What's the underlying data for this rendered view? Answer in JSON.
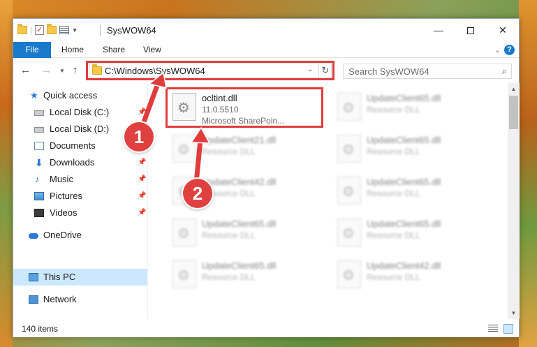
{
  "window": {
    "title": "SysWOW64",
    "controls": {
      "minimize": "—",
      "close": "✕"
    }
  },
  "ribbon": {
    "tabs": [
      "File",
      "Home",
      "Share",
      "View"
    ],
    "help": "?"
  },
  "nav": {
    "address": "C:\\Windows\\SysWOW64",
    "search_placeholder": "Search SysWOW64"
  },
  "sidebar": {
    "items": [
      {
        "label": "Quick access"
      },
      {
        "label": "Local Disk (C:)",
        "pinned": true
      },
      {
        "label": "Local Disk (D:)"
      },
      {
        "label": "Documents",
        "pinned": true
      },
      {
        "label": "Downloads",
        "pinned": true
      },
      {
        "label": "Music",
        "pinned": true
      },
      {
        "label": "Pictures",
        "pinned": true
      },
      {
        "label": "Videos",
        "pinned": true
      },
      {
        "label": "OneDrive"
      },
      {
        "label": "This PC",
        "selected": true
      },
      {
        "label": "Network"
      }
    ]
  },
  "files": [
    {
      "name": "ocltint.dll",
      "line1": "11.0.5510",
      "line2": "Microsoft SharePoin...",
      "highlighted": true
    },
    {
      "name": "UpdateClient65.dll",
      "line1": "Resource DLL"
    },
    {
      "name": "UpdateClient21.dll",
      "line1": "Resource DLL"
    },
    {
      "name": "UpdateClient65.dll",
      "line1": "Resource DLL"
    },
    {
      "name": "UpdateClient42.dll",
      "line1": "Resource DLL"
    },
    {
      "name": "UpdateClient65.dll",
      "line1": "Resource DLL"
    },
    {
      "name": "UpdateClient65.dll",
      "line1": "Resource DLL"
    },
    {
      "name": "UpdateClient65.dll",
      "line1": "Resource DLL"
    },
    {
      "name": "UpdateClient65.dll",
      "line1": "Resource DLL"
    },
    {
      "name": "UpdateClient42.dll",
      "line1": "Resource DLL"
    }
  ],
  "status": {
    "count": "140 items"
  },
  "annotations": {
    "badge1": "1",
    "badge2": "2",
    "accent_color": "#e03c3c"
  },
  "icons": {
    "pin": "📌",
    "refresh": "↻",
    "search": "⌕"
  }
}
